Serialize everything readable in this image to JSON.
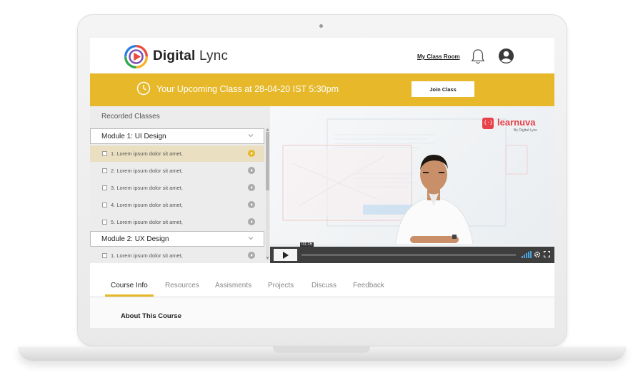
{
  "header": {
    "logo_bold": "Digital",
    "logo_light": " Lync",
    "my_class_room": "My Class Room",
    "icons": {
      "notifications": "bell-icon",
      "profile": "user-avatar-icon"
    }
  },
  "upcoming": {
    "text": "Your Upcoming Class at 28-04-20 IST 5:30pm",
    "join_label": "Join Class",
    "color": "#e6b82a"
  },
  "sidebar": {
    "title": "Recorded Classes",
    "modules": [
      {
        "label": "Module 1: UI Design",
        "lessons": [
          {
            "label": "1. Lorem ipsum dolor sit amet,",
            "active": true
          },
          {
            "label": "2. Lorem ipsum dolor sit amet,",
            "active": false
          },
          {
            "label": "3. Lorem ipsum dolor sit amet,",
            "active": false
          },
          {
            "label": "4. Lorem ipsum dolor sit amet,",
            "active": false
          },
          {
            "label": "5. Lorem ipsum dolor sit amet,",
            "active": false
          }
        ]
      },
      {
        "label": "Module 2: UX Design",
        "lessons": [
          {
            "label": "1. Lorem ipsum dolor sit amet,",
            "active": false
          }
        ]
      }
    ]
  },
  "video": {
    "brand_name": "learnuva",
    "brand_sub": "By Digital Lync",
    "timecode": "01:15",
    "progress": 0.0
  },
  "tabs": [
    {
      "label": "Course Info",
      "active": true
    },
    {
      "label": "Resources",
      "active": false
    },
    {
      "label": "Assisments",
      "active": false
    },
    {
      "label": "Projects",
      "active": false
    },
    {
      "label": "Discuss",
      "active": false
    },
    {
      "label": "Feedback",
      "active": false
    }
  ],
  "content": {
    "about_title": "About This Course"
  }
}
